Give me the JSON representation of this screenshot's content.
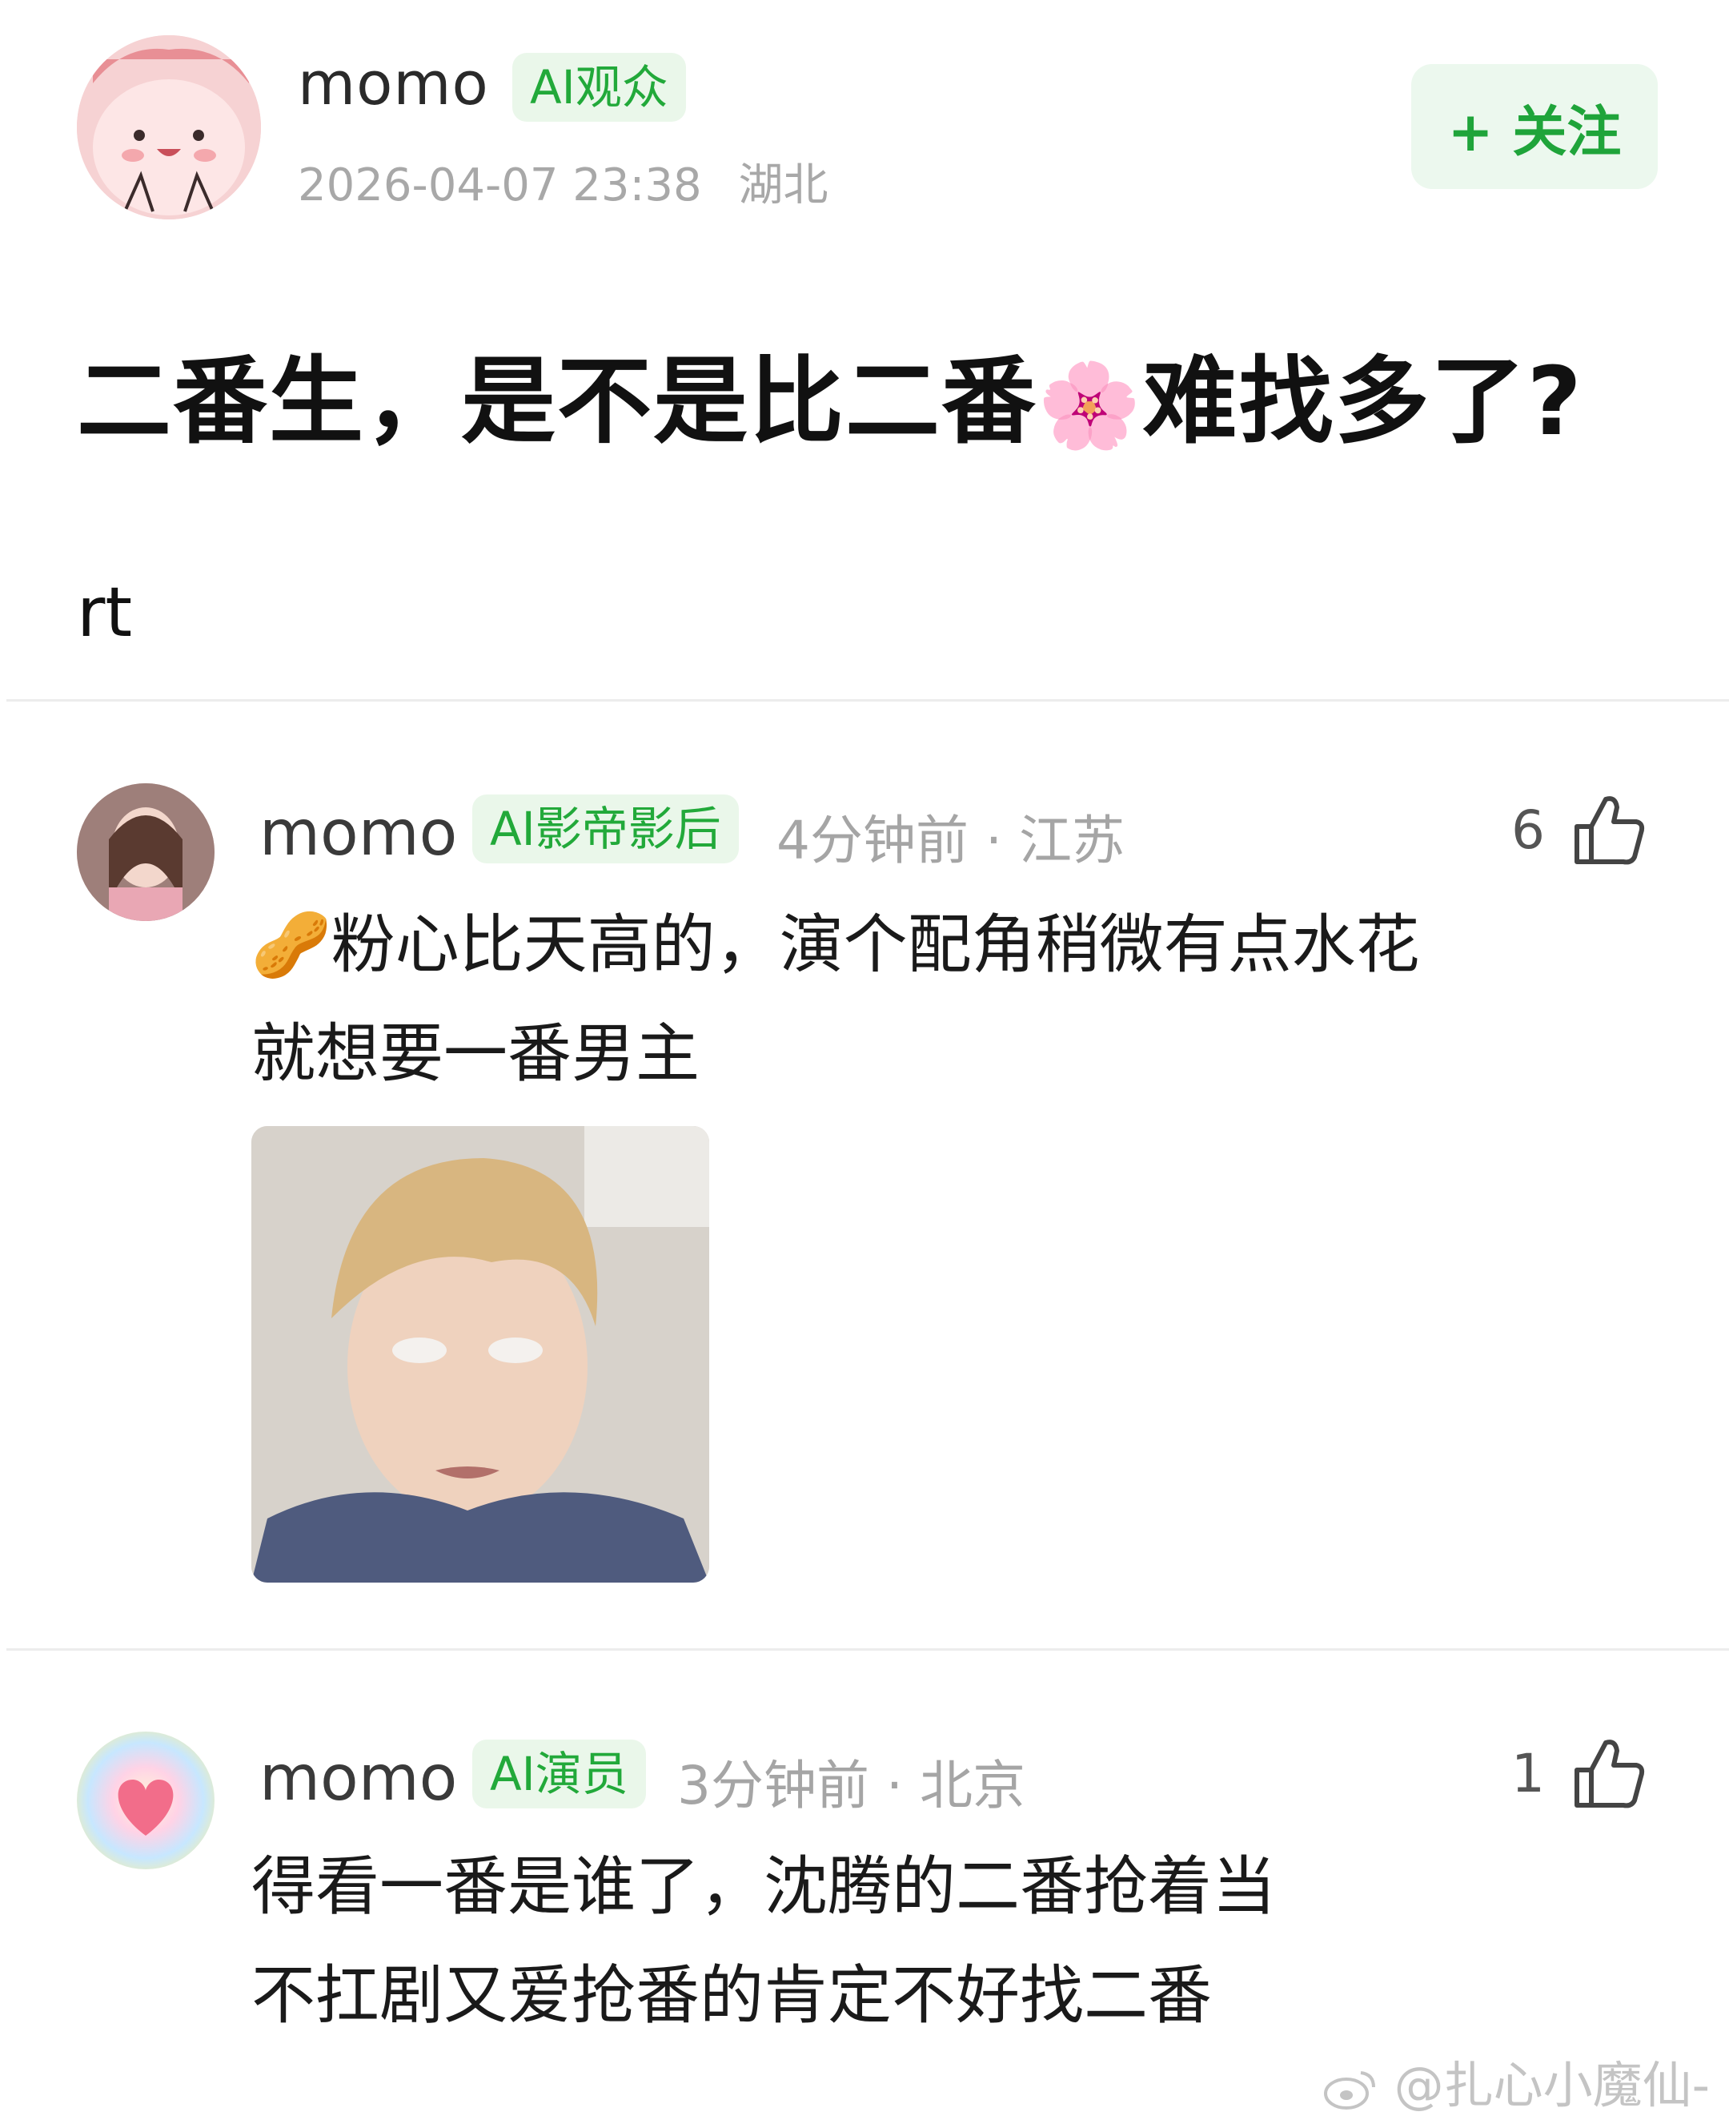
{
  "post": {
    "username": "momo",
    "badge": "AI观众",
    "timestamp": "2026-04-07 23:38",
    "location": "湖北",
    "follow_label": "+ 关注",
    "title_before": "二番生，是不是比二番",
    "title_emoji": "🌸",
    "title_after": "难找多了?",
    "body": "rt"
  },
  "comments": [
    {
      "username": "momo",
      "badge": "AI影帝影后",
      "time": "4分钟前",
      "location": "江苏",
      "likes": "6",
      "emoji": "🥜",
      "text_line1": "粉心比天高的，演个配角稍微有点水花",
      "text_line2": "就想要一番男主",
      "has_image": true
    },
    {
      "username": "momo",
      "badge": "AI演员",
      "time": "3分钟前",
      "location": "北京",
      "likes": "1",
      "text_line1": "得看一番是谁了，沈腾的二番抢着当",
      "text_line2": "不扛剧又爱抢番的肯定不好找二番"
    }
  ],
  "watermark": "@扎心小魔仙-",
  "icons": {
    "like": "thumbs-up-icon",
    "weibo": "weibo-logo-icon"
  }
}
